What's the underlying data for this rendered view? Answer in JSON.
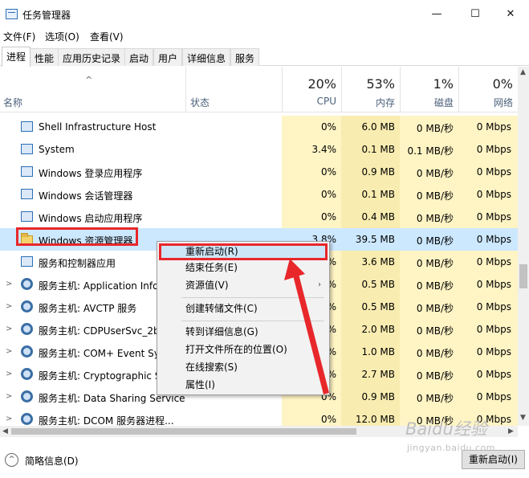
{
  "window": {
    "title": "任务管理器",
    "minimize": "—",
    "maximize": "☐",
    "close": "✕"
  },
  "menu": [
    {
      "label": "文件(F)"
    },
    {
      "label": "选项(O)"
    },
    {
      "label": "查看(V)"
    }
  ],
  "tabs": [
    {
      "label": "进程"
    },
    {
      "label": "性能"
    },
    {
      "label": "应用历史记录"
    },
    {
      "label": "启动"
    },
    {
      "label": "用户"
    },
    {
      "label": "详细信息"
    },
    {
      "label": "服务"
    }
  ],
  "columns": {
    "sort_arrow": "^",
    "name": "名称",
    "status": "状态",
    "cpu": {
      "pct": "20%",
      "label": "CPU"
    },
    "memory": {
      "pct": "53%",
      "label": "内存"
    },
    "disk": {
      "pct": "1%",
      "label": "磁盘"
    },
    "network": {
      "pct": "0%",
      "label": "网络"
    }
  },
  "processes": [
    {
      "name": "Shell Infrastructure Host",
      "cpu": "0%",
      "mem": "6.0 MB",
      "disk": "0 MB/秒",
      "net": "0 Mbps",
      "icon": "window-icon"
    },
    {
      "name": "System",
      "cpu": "3.4%",
      "mem": "0.1 MB",
      "disk": "0.1 MB/秒",
      "net": "0 Mbps",
      "icon": "window-icon"
    },
    {
      "name": "Windows 登录应用程序",
      "cpu": "0%",
      "mem": "0.9 MB",
      "disk": "0 MB/秒",
      "net": "0 Mbps",
      "icon": "window-icon"
    },
    {
      "name": "Windows 会话管理器",
      "cpu": "0%",
      "mem": "0.1 MB",
      "disk": "0 MB/秒",
      "net": "0 Mbps",
      "icon": "window-icon"
    },
    {
      "name": "Windows 启动应用程序",
      "cpu": "0%",
      "mem": "0.4 MB",
      "disk": "0 MB/秒",
      "net": "0 Mbps",
      "icon": "window-icon"
    },
    {
      "name": "Windows 资源管理器",
      "cpu": "3.8%",
      "mem": "39.5 MB",
      "disk": "0 MB/秒",
      "net": "0 Mbps",
      "icon": "folder-icon"
    },
    {
      "name": "服务和控制器应用",
      "cpu": "0%",
      "mem": "3.6 MB",
      "disk": "0 MB/秒",
      "net": "0 Mbps",
      "icon": "window-icon"
    },
    {
      "name": "服务主机: Application Information",
      "cpu": "0%",
      "mem": "0.5 MB",
      "disk": "0 MB/秒",
      "net": "0 Mbps",
      "icon": "gear-icon"
    },
    {
      "name": "服务主机: AVCTP 服务",
      "cpu": "0%",
      "mem": "0.5 MB",
      "disk": "0 MB/秒",
      "net": "0 Mbps",
      "icon": "gear-icon"
    },
    {
      "name": "服务主机: CDPUserSvc_2b6",
      "cpu": "0%",
      "mem": "2.0 MB",
      "disk": "0 MB/秒",
      "net": "0 Mbps",
      "icon": "gear-icon"
    },
    {
      "name": "服务主机: COM+ Event System",
      "cpu": "0%",
      "mem": "1.0 MB",
      "disk": "0 MB/秒",
      "net": "0 Mbps",
      "icon": "gear-icon"
    },
    {
      "name": "服务主机: Cryptographic Services",
      "cpu": "0%",
      "mem": "2.7 MB",
      "disk": "0 MB/秒",
      "net": "0 Mbps",
      "icon": "gear-icon"
    },
    {
      "name": "服务主机: Data Sharing Service",
      "cpu": "0%",
      "mem": "0.9 MB",
      "disk": "0 MB/秒",
      "net": "0 Mbps",
      "icon": "gear-icon"
    },
    {
      "name": "服务主机: DCOM 服务器进程...",
      "cpu": "0%",
      "mem": "12.0 MB",
      "disk": "0 MB/秒",
      "net": "0 Mbps",
      "icon": "gear-icon"
    }
  ],
  "context_menu": {
    "restart": "重新启动(R)",
    "end_task": "结束任务(E)",
    "resource_values": "资源值(V)",
    "create_dump": "创建转储文件(C)",
    "go_to_details": "转到详细信息(G)",
    "open_file_location": "打开文件所在的位置(O)",
    "search_online": "在线搜索(S)",
    "properties": "属性(I)"
  },
  "footer": {
    "fewer_details": "简略信息(D)",
    "restart_button": "重新启动(I)"
  },
  "watermark": {
    "text": "Baidu经验",
    "sub": "jingyan.baidu.com"
  },
  "colors": {
    "heat_light": "#fff4c4",
    "heat_medium": "#f9ecb0",
    "selected_row": "#cce8ff",
    "annotation_red": "#e8272b"
  }
}
